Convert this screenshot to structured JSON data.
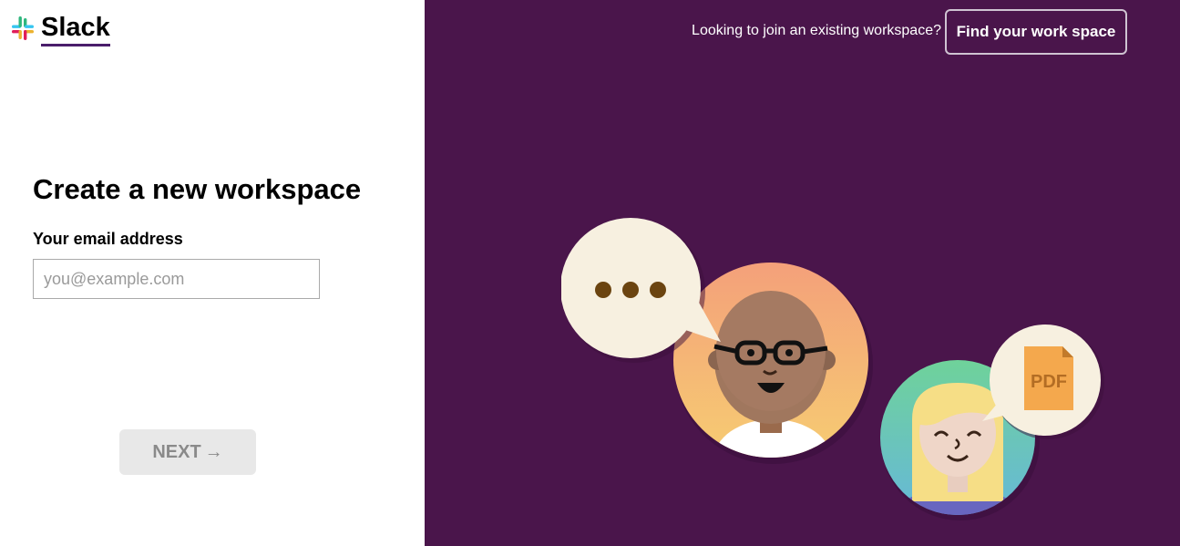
{
  "brand": {
    "name": "Slack",
    "accent_underline": "#4a1d6b",
    "logo_colors": [
      "#36c5f0",
      "#2eb67d",
      "#ecb22e",
      "#e01e5a"
    ]
  },
  "form": {
    "title": "Create a new workspace",
    "email_label": "Your email address",
    "email_placeholder": "you@example.com",
    "email_value": "",
    "next_label": "NEXT",
    "next_arrow": "→"
  },
  "header_right": {
    "join_prompt": "Looking to join an existing workspace?",
    "find_button_label": "Find your work space"
  },
  "illustration": {
    "bubble_icon": "ellipsis-icon",
    "file_label": "PDF",
    "background_color": "#4a154b"
  }
}
